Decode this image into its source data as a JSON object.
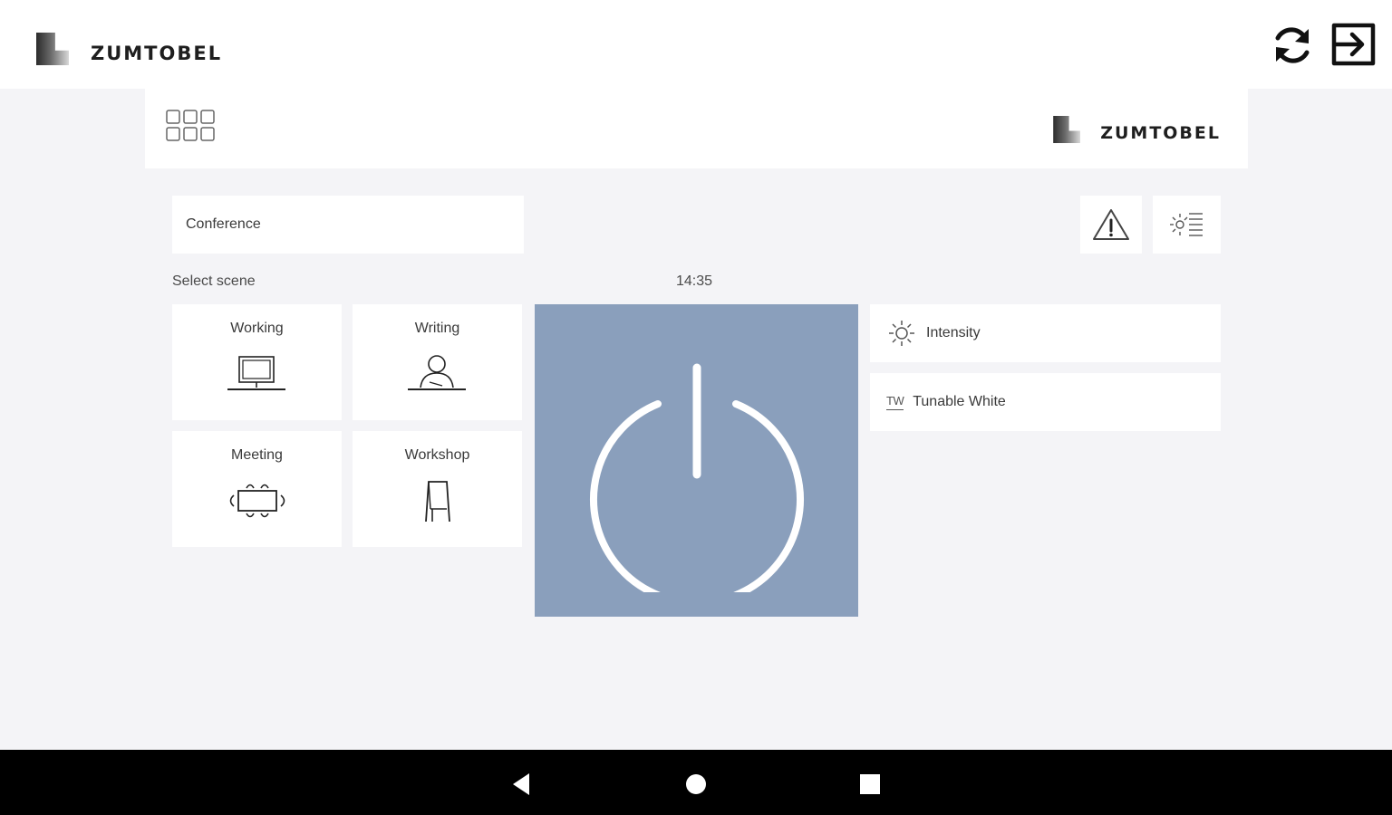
{
  "app": {
    "brand_name": "ZUMTOBEL",
    "actions": [
      {
        "icon": "refresh-icon"
      },
      {
        "icon": "logout-icon"
      }
    ]
  },
  "panel": {
    "menu_icon": "grid-menu-icon",
    "brand_name": "ZUMTOBEL"
  },
  "room": {
    "name": "Conference"
  },
  "toolbar": {
    "warning_icon": "warning-icon",
    "list_icon": "light-list-icon"
  },
  "scenes": {
    "label": "Select scene",
    "items": [
      {
        "label": "Working",
        "icon": "computer-desk-icon"
      },
      {
        "label": "Writing",
        "icon": "person-writing-icon"
      },
      {
        "label": "Meeting",
        "icon": "meeting-table-icon"
      },
      {
        "label": "Workshop",
        "icon": "flipchart-icon"
      }
    ]
  },
  "clock": {
    "time": "14:35"
  },
  "power": {
    "icon": "power-icon",
    "color": "#8a9fbc"
  },
  "controls": [
    {
      "label": "Intensity",
      "icon": "sun-icon"
    },
    {
      "label": "Tunable White",
      "icon_text": "TW"
    }
  ],
  "system_nav": {
    "buttons": [
      "back-icon",
      "home-icon",
      "recent-apps-icon"
    ]
  }
}
